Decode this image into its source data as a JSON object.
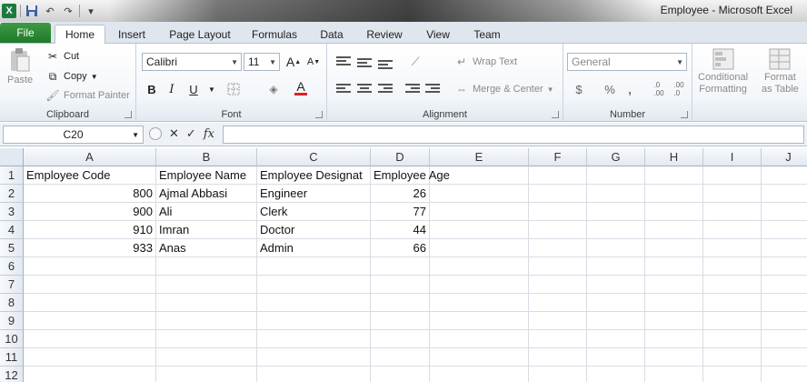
{
  "window": {
    "title": "Employee  -  Microsoft Excel",
    "app_icon_letter": "X"
  },
  "quick_access": [
    "save-icon",
    "undo-icon",
    "redo-icon",
    "customize-icon"
  ],
  "ribbon_tabs": [
    "File",
    "Home",
    "Insert",
    "Page Layout",
    "Formulas",
    "Data",
    "Review",
    "View",
    "Team"
  ],
  "active_tab": "Home",
  "ribbon": {
    "clipboard": {
      "paste": "Paste",
      "cut": "Cut",
      "copy": "Copy",
      "format_painter": "Format Painter",
      "label": "Clipboard"
    },
    "font": {
      "name": "Calibri",
      "size": "11",
      "grow": "A",
      "shrink": "A",
      "bold": "B",
      "italic": "I",
      "underline": "U",
      "font_color_letter": "A",
      "label": "Font"
    },
    "alignment": {
      "wrap_text": "Wrap Text",
      "merge_center": "Merge & Center",
      "label": "Alignment"
    },
    "number": {
      "format": "General",
      "currency": "$",
      "percent": "%",
      "comma": ",",
      "inc_decimal": ".00 → .0",
      "label": "Number"
    },
    "styles": {
      "conditional_1": "Conditional",
      "conditional_2": "Formatting",
      "format_1": "Format",
      "format_2": "as Table"
    }
  },
  "formula_bar": {
    "name_box": "C20",
    "fx": "fx",
    "value": ""
  },
  "sheet": {
    "columns": [
      "A",
      "B",
      "C",
      "D",
      "E",
      "F",
      "G",
      "H",
      "I",
      "J"
    ],
    "rows": [
      "1",
      "2",
      "3",
      "4",
      "5",
      "6",
      "7",
      "8",
      "9",
      "10",
      "11",
      "12"
    ],
    "headers": [
      "Employee Code",
      "Employee Name",
      "Employee Designat",
      "Employee Age"
    ],
    "data": [
      [
        "800",
        "Ajmal Abbasi",
        "Engineer",
        "26"
      ],
      [
        "900",
        "Ali",
        "Clerk",
        "77"
      ],
      [
        "910",
        "Imran",
        "Doctor",
        "44"
      ],
      [
        "933",
        "Anas",
        "Admin",
        "66"
      ]
    ]
  },
  "colors": {
    "file_tab": "#1e7a2a",
    "excel_green": "#1d7a3e",
    "font_color_bar": "#e02020"
  }
}
